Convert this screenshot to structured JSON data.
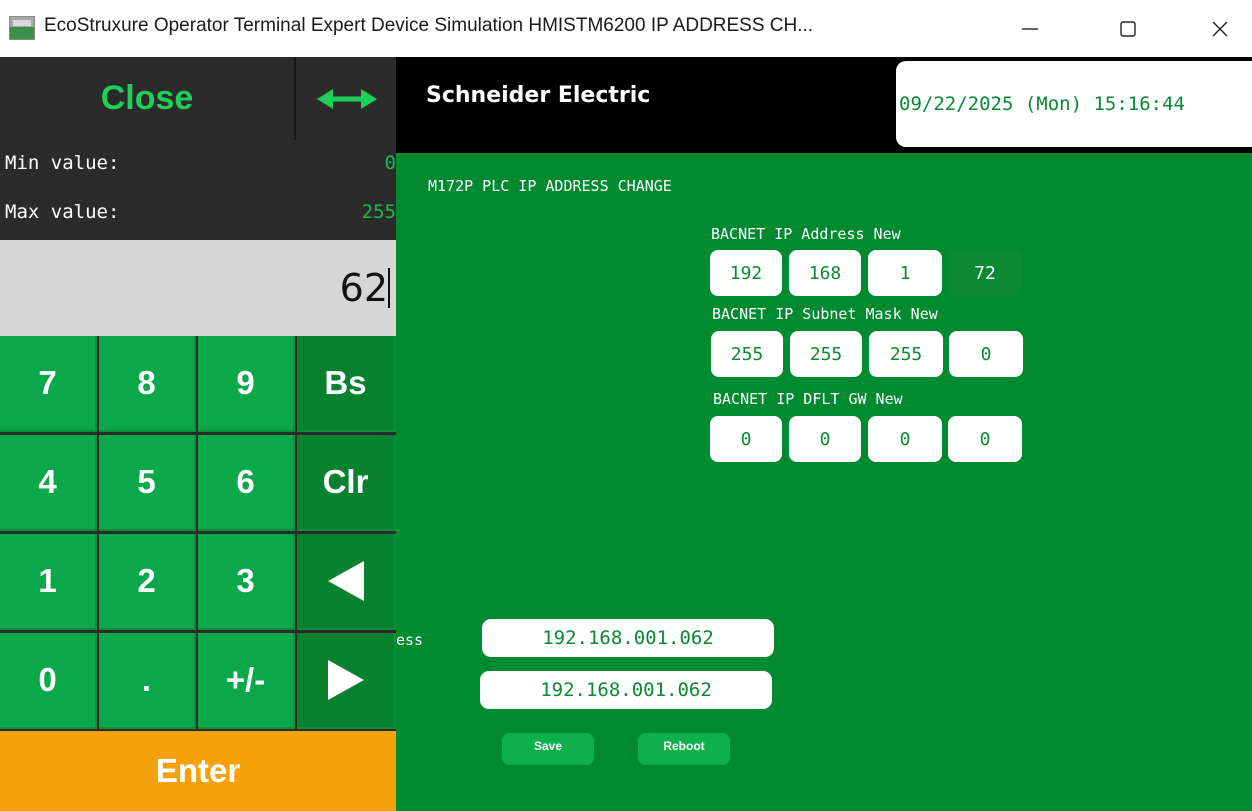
{
  "window": {
    "title": "EcoStruxure Operator Terminal Expert Device Simulation HMISTM6200 IP ADDRESS CH...",
    "app_icon": "hmi-app-icon",
    "controls": {
      "minimize": "—",
      "maximize": "☐",
      "close": "✕"
    }
  },
  "header": {
    "brand": "Schneider Electric",
    "datetime": "09/22/2025 (Mon) 15:16:44"
  },
  "screen": {
    "title": "M172P PLC IP ADDRESS CHANGE",
    "ip_address_new": {
      "label": "BACNET IP Address New",
      "octets": [
        "192",
        "168",
        "1",
        "72"
      ]
    },
    "subnet_mask_new": {
      "label": "BACNET IP Subnet Mask New",
      "octets": [
        "255",
        "255",
        "255",
        "0"
      ]
    },
    "default_gw_new": {
      "label": "BACNET IP DFLT GW New",
      "octets": [
        "0",
        "0",
        "0",
        "0"
      ]
    },
    "partial_label": "ess",
    "current_ip_1": "192.168.001.062",
    "current_ip_2": "192.168.001.062",
    "save_label": "Save",
    "reboot_label": "Reboot"
  },
  "keypad": {
    "close_label": "Close",
    "move_icon": "left-right-arrow-icon",
    "min_label": "Min value:",
    "min_value": "0",
    "max_label": "Max value:",
    "max_value": "255",
    "display_value": "62",
    "keys": {
      "k7": "7",
      "k8": "8",
      "k9": "9",
      "bs": "Bs",
      "k4": "4",
      "k5": "5",
      "k6": "6",
      "clr": "Clr",
      "k1": "1",
      "k2": "2",
      "k3": "3",
      "k0": "0",
      "dot": ".",
      "plusminus": "+/-"
    },
    "enter_label": "Enter"
  },
  "colors": {
    "hmi_green": "#018a2f",
    "key_green": "#0aa84a",
    "enter_orange": "#f5a10a",
    "text_green": "#0b8a34"
  }
}
